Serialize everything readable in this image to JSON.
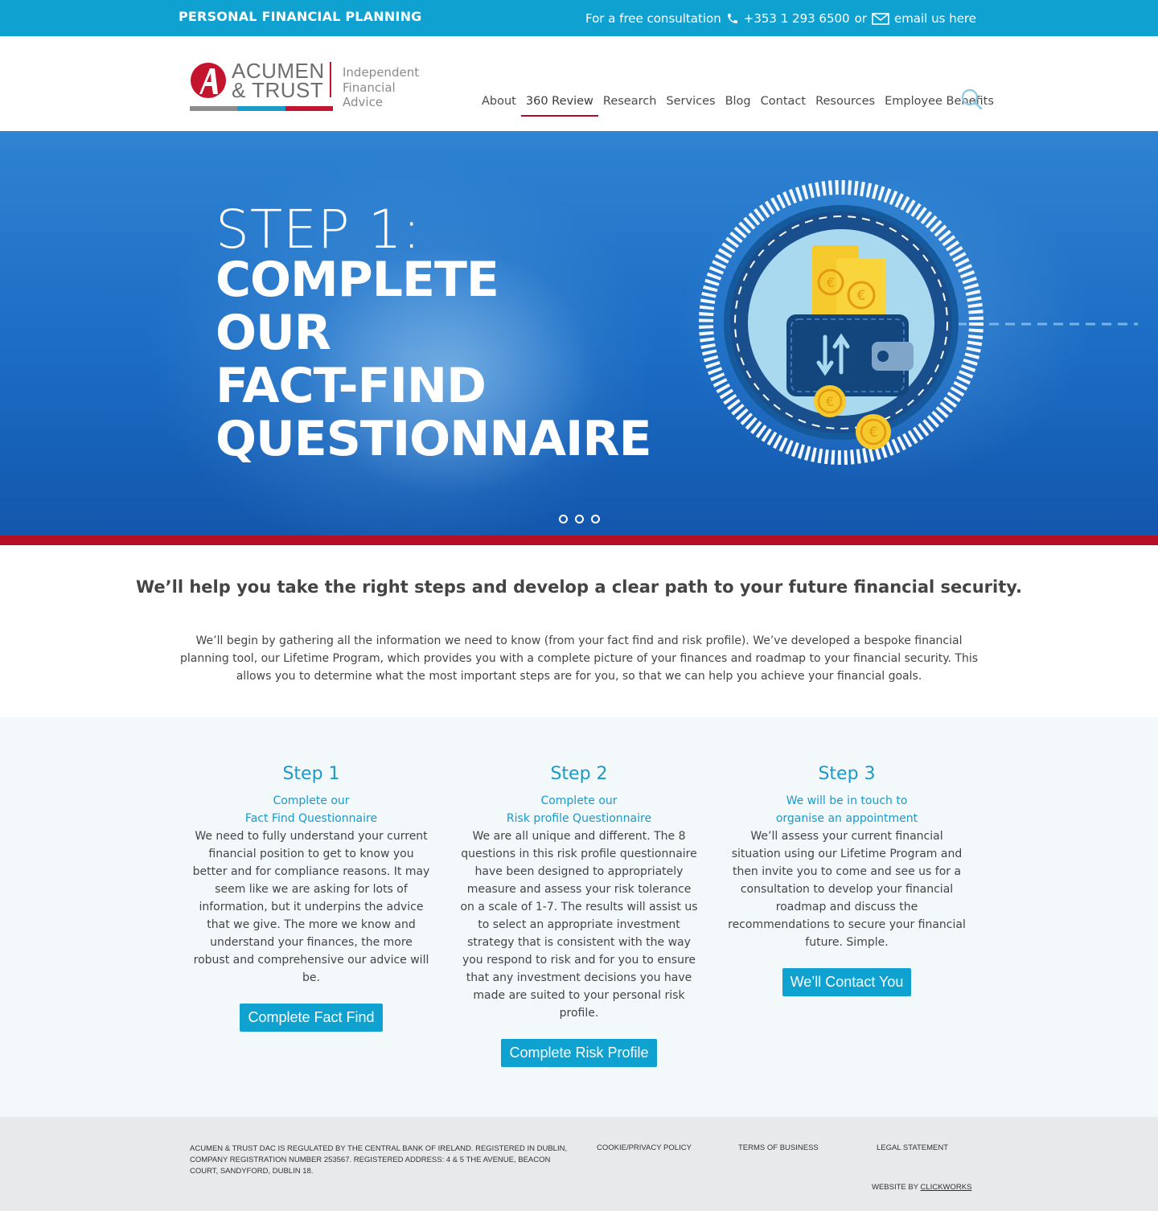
{
  "topbar": {
    "title": "PERSONAL FINANCIAL PLANNING",
    "consult_text": "For a free consultation",
    "phone": "+353 1 293 6500",
    "or_text": "or",
    "email_link": "email us here"
  },
  "logo": {
    "name_line1": "ACUMEN",
    "name_line2": "& TRUST",
    "tagline_line1": "Independent",
    "tagline_line2": "Financial Advice",
    "colors": {
      "red": "#c4152f",
      "grey": "#8c8c8c",
      "blue": "#1a9ac9"
    }
  },
  "nav": {
    "items": [
      "About",
      "360 Review",
      "Research",
      "Services",
      "Blog",
      "Contact",
      "Resources",
      "Employee Benefits"
    ],
    "active": "360 Review"
  },
  "hero": {
    "step_label": "STEP 1:",
    "headline": [
      "COMPLETE",
      "OUR",
      "FACT-FIND",
      "QUESTIONNAIRE"
    ],
    "slides": 3,
    "icon": "wallet-euro-icon"
  },
  "intro": {
    "heading": "We’ll help you take the right steps and develop a clear path to your future financial security.",
    "paragraph": "We’ll begin by gathering all the information we need to know (from your fact find and risk profile). We’ve developed a bespoke financial planning tool, our Lifetime Program, which provides you with a complete picture of your finances and roadmap to your financial security. This allows you to determine what the most important steps are for you, so that we can help you achieve your financial goals."
  },
  "steps": [
    {
      "title": "Step 1",
      "sub_line1": "Complete our",
      "sub_line2": "Fact Find Questionnaire",
      "body": "We need to fully understand your current financial position to get to know you better and for compliance reasons. It may seem like we are asking for lots of information, but it underpins the advice that we give. The more we know and understand your finances, the more robust and comprehensive our advice will be.",
      "button": "Complete Fact Find"
    },
    {
      "title": "Step 2",
      "sub_line1": "Complete our",
      "sub_line2": "Risk profile Questionnaire",
      "body": "We are all unique and different. The 8 questions in this risk profile questionnaire have been designed to appropriately measure and assess your risk tolerance on a scale of 1-7. The results will assist us to select an appropriate investment strategy that is consistent with the way you respond to risk and for you to ensure that any investment decisions you have made are suited to your personal risk profile.",
      "button": "Complete Risk Profile"
    },
    {
      "title": "Step 3",
      "sub_line1": "We will be in touch to",
      "sub_line2": "organise an appointment",
      "body": "We’ll assess your current financial situation using our Lifetime Program and then invite you to come and see us for a consultation to develop your financial roadmap and discuss the recommendations to secure your financial future. Simple.",
      "button": "We’ll Contact You"
    }
  ],
  "footer": {
    "legal": "ACUMEN & TRUST DAC IS REGULATED BY THE CENTRAL BANK OF IRELAND. REGISTERED IN DUBLIN, COMPANY REGISTRATION NUMBER 253567. REGISTERED ADDRESS: 4 & 5 THE AVENUE, BEACON COURT, SANDYFORD, DUBLIN 18.",
    "links": [
      "COOKIE/PRIVACY POLICY",
      "TERMS OF BUSINESS",
      "LEGAL STATEMENT"
    ],
    "credit_prefix": "WEBSITE BY",
    "credit_link": "CLICKWORKS"
  },
  "colors": {
    "accent_blue": "#0fa1cf",
    "brand_red": "#b50f27",
    "steps_bg": "#f3f8fb",
    "footer_bg": "#e8e9ea"
  }
}
